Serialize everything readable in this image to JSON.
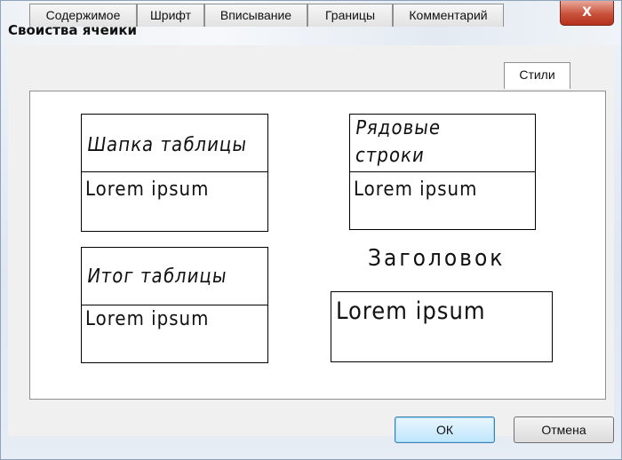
{
  "window": {
    "title": "Свойства ячейки",
    "close_glyph": "X"
  },
  "tabs": [
    {
      "label": "Содержимое"
    },
    {
      "label": "Шрифт"
    },
    {
      "label": "Вписывание"
    },
    {
      "label": "Границы"
    },
    {
      "label": "Комментарий"
    },
    {
      "label": "Стили",
      "active": true
    }
  ],
  "styles": {
    "header": {
      "label": "Шапка таблицы",
      "sample": "Lorem ipsum"
    },
    "rows": {
      "label_line1": "Рядовые",
      "label_line2": "строки",
      "sample": "Lorem ipsum"
    },
    "total": {
      "label": "Итог таблицы",
      "sample": "Lorem ipsum"
    },
    "title": {
      "label": "Заголовок",
      "sample": "Lorem ipsum"
    }
  },
  "buttons": {
    "ok": "ОК",
    "cancel": "Отмена"
  }
}
